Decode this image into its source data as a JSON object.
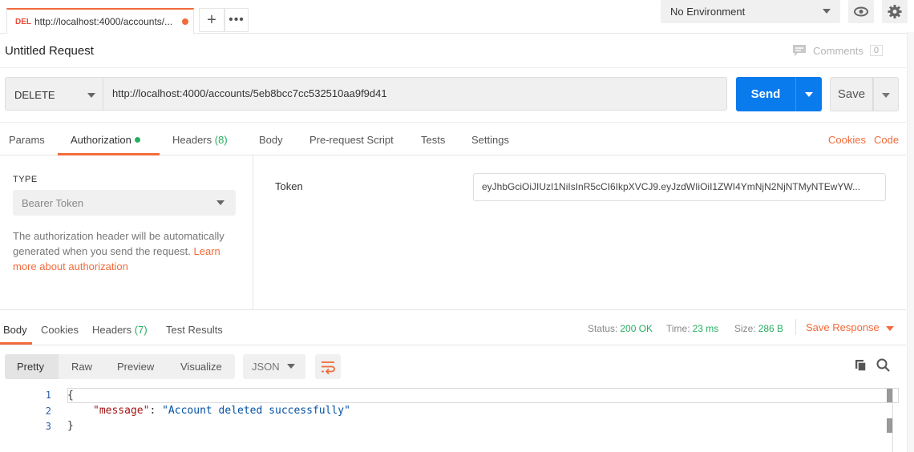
{
  "tabs": [
    {
      "method": "DEL",
      "url": "http://localhost:4000/accounts/..."
    }
  ],
  "environment": {
    "selected": "No Environment"
  },
  "request": {
    "name": "Untitled Request",
    "comments_label": "Comments",
    "comments_count": "0",
    "method": "DELETE",
    "url": "http://localhost:4000/accounts/5eb8bcc7cc532510aa9f9d41",
    "send_label": "Send",
    "save_label": "Save"
  },
  "request_tabs": {
    "params": "Params",
    "authorization": "Authorization",
    "headers": "Headers",
    "headers_count": "(8)",
    "body": "Body",
    "prerequest": "Pre-request Script",
    "tests": "Tests",
    "settings": "Settings",
    "cookies": "Cookies",
    "code": "Code"
  },
  "auth": {
    "type_label": "TYPE",
    "type_value": "Bearer Token",
    "description": "The authorization header will be automatically generated when you send the request. ",
    "learn_more": "Learn more about authorization",
    "token_label": "Token",
    "token_value": "eyJhbGciOiJIUzI1NiIsInR5cCI6IkpXVCJ9.eyJzdWIiOiI1ZWI4YmNjN2NjNTMyNTEwYW..."
  },
  "response_tabs": {
    "body": "Body",
    "cookies": "Cookies",
    "headers": "Headers",
    "headers_count": "(7)",
    "test_results": "Test Results"
  },
  "response_meta": {
    "status_label": "Status:",
    "status_value": "200 OK",
    "time_label": "Time:",
    "time_value": "23 ms",
    "size_label": "Size:",
    "size_value": "286 B",
    "save_response": "Save Response"
  },
  "viewer": {
    "modes": [
      "Pretty",
      "Raw",
      "Preview",
      "Visualize"
    ],
    "format": "JSON"
  },
  "response_body": {
    "line_numbers": [
      "1",
      "2",
      "3"
    ],
    "open_brace": "{",
    "key": "\"message\"",
    "colon": ": ",
    "value": "\"Account deleted successfully\"",
    "close_brace": "}"
  },
  "colors": {
    "accent": "#f26b3a",
    "send_blue": "#097bed",
    "status_green": "#27ae60"
  }
}
